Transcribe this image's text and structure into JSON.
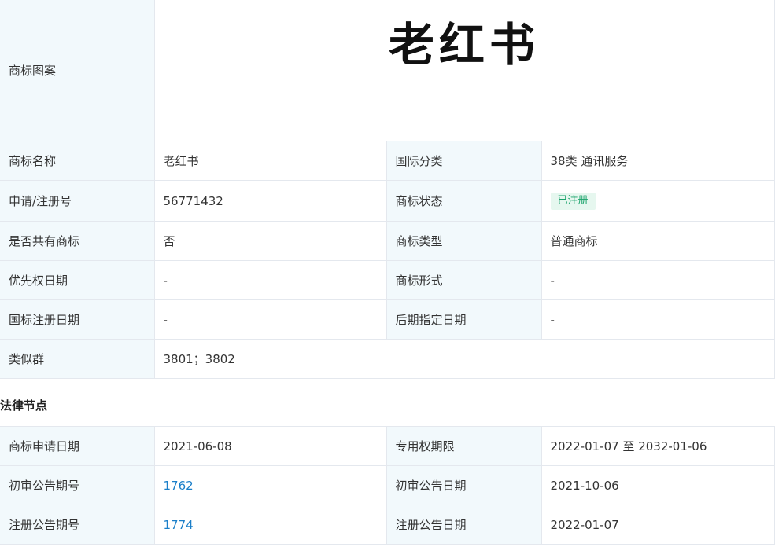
{
  "logo": {
    "label": "商标图案",
    "text": "老红书"
  },
  "info": {
    "name_label": "商标名称",
    "name_value": "老红书",
    "intl_class_label": "国际分类",
    "intl_class_value": "38类 通讯服务",
    "reg_no_label": "申请/注册号",
    "reg_no_value": "56771432",
    "status_label": "商标状态",
    "status_value": "已注册",
    "shared_label": "是否共有商标",
    "shared_value": "否",
    "type_label": "商标类型",
    "type_value": "普通商标",
    "priority_label": "优先权日期",
    "priority_value": "-",
    "form_label": "商标形式",
    "form_value": "-",
    "intl_reg_label": "国标注册日期",
    "intl_reg_value": "-",
    "later_label": "后期指定日期",
    "later_value": "-",
    "similar_label": "类似群",
    "similar_value": "3801；3802"
  },
  "legal": {
    "title": "法律节点",
    "apply_date_label": "商标申请日期",
    "apply_date_value": "2021-06-08",
    "exclusive_label": "专用权期限",
    "exclusive_value": "2022-01-07 至 2032-01-06",
    "prelim_no_label": "初审公告期号",
    "prelim_no_value": "1762",
    "prelim_date_label": "初审公告日期",
    "prelim_date_value": "2021-10-06",
    "reg_no_label": "注册公告期号",
    "reg_no_value": "1774",
    "reg_date_label": "注册公告日期",
    "reg_date_value": "2022-01-07"
  },
  "colors": {
    "label_bg": "#f2f9fc",
    "border": "#e4e8ee",
    "link": "#1b7fc9",
    "badge_bg": "#e6f7ef",
    "badge_text": "#1aa36b"
  }
}
